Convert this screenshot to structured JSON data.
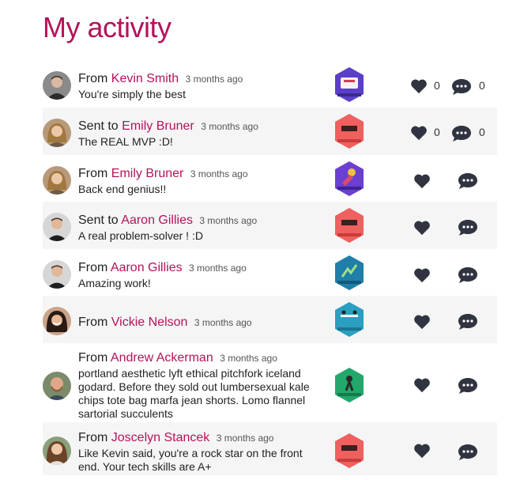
{
  "page": {
    "title": "My activity"
  },
  "colors": {
    "accent": "#b3135a",
    "icon": "#2f3440",
    "alt_row": "#f5f5f5"
  },
  "activities": [
    {
      "direction": "From",
      "person": "Kevin Smith",
      "time": "3 months ago",
      "message": "You're simply the best",
      "badge": "super-recognizer-badge-icon",
      "likes": "0",
      "comments": "0"
    },
    {
      "direction": "Sent to",
      "person": "Emily Bruner",
      "time": "3 months ago",
      "message": "The REAL MVP :D!",
      "badge": "mvp-badge-icon",
      "likes": "0",
      "comments": "0"
    },
    {
      "direction": "From",
      "person": "Emily Bruner",
      "time": "3 months ago",
      "message": "Back end genius!!",
      "badge": "problem-solver-badge-icon"
    },
    {
      "direction": "Sent to",
      "person": "Aaron Gillies",
      "time": "3 months ago",
      "message": "A real problem-solver ! :D",
      "badge": "mvp-badge-icon"
    },
    {
      "direction": "From",
      "person": "Aaron Gillies",
      "time": "3 months ago",
      "message": "Amazing work!",
      "badge": "over-achiever-badge-icon"
    },
    {
      "direction": "From",
      "person": "Vickie Nelson",
      "time": "3 months ago",
      "message": "",
      "badge": "helping-hand-badge-icon"
    },
    {
      "direction": "From",
      "person": "Andrew Ackerman",
      "time": "3 months ago",
      "message": "portland aesthetic lyft ethical pitchfork iceland godard. Before they sold out lumbersexual kale chips tote bag marfa jean shorts. Lomo flannel sartorial succulents",
      "badge": "get-moving-badge-icon"
    },
    {
      "direction": "From",
      "person": "Joscelyn Stancek",
      "time": "3 months ago",
      "message": "Like Kevin said, you're a rock star on the front end. Your tech skills are A+",
      "badge": "mvp-badge-icon"
    }
  ]
}
